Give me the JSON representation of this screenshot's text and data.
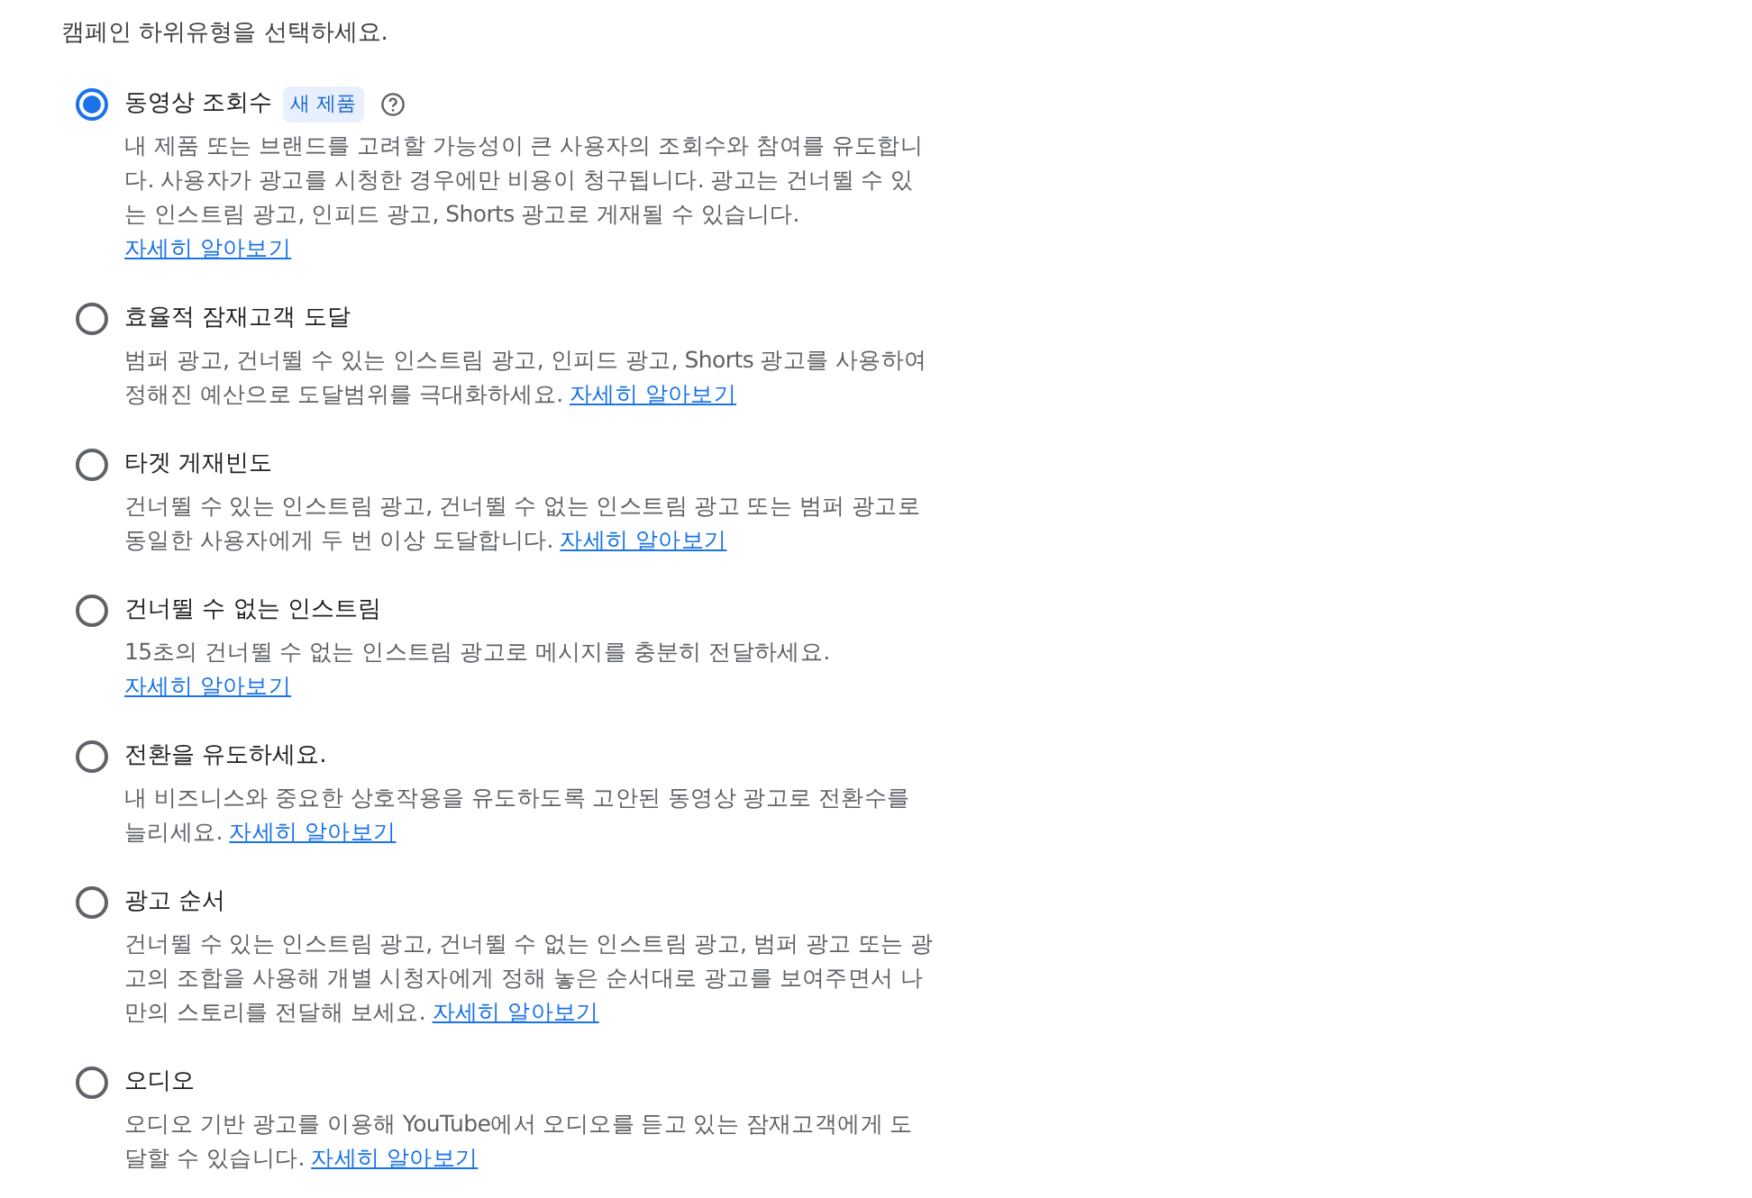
{
  "heading": "캠페인 하위유형을 선택하세요.",
  "options": [
    {
      "label": "동영상 조회수",
      "selected": true,
      "badge": "새 제품",
      "help": true,
      "description": "내 제품 또는 브랜드를 고려할 가능성이 큰 사용자의 조회수와 참여를 유도합니다. 사용자가 광고를 시청한 경우에만 비용이 청구됩니다. 광고는 건너뛸 수 있는 인스트림 광고, 인피드 광고, Shorts 광고로 게재될 수 있습니다.",
      "link": "자세히 알아보기"
    },
    {
      "label": "효율적 잠재고객 도달",
      "selected": false,
      "help": false,
      "description": "범퍼 광고, 건너뛸 수 있는 인스트림 광고, 인피드 광고, Shorts 광고를 사용하여 정해진 예산으로 도달범위를 극대화하세요.",
      "link": "자세히 알아보기"
    },
    {
      "label": "타겟 게재빈도",
      "selected": false,
      "help": false,
      "description": "건너뛸 수 있는 인스트림 광고, 건너뛸 수 없는 인스트림 광고 또는 범퍼 광고로 동일한 사용자에게 두 번 이상 도달합니다.",
      "link": "자세히 알아보기"
    },
    {
      "label": "건너뛸 수 없는 인스트림",
      "selected": false,
      "help": false,
      "description": "15초의 건너뛸 수 없는 인스트림 광고로 메시지를 충분히 전달하세요.",
      "link": "자세히 알아보기"
    },
    {
      "label": "전환을 유도하세요.",
      "selected": false,
      "help": false,
      "description": "내 비즈니스와 중요한 상호작용을 유도하도록 고안된 동영상 광고로 전환수를 늘리세요.",
      "link": "자세히 알아보기"
    },
    {
      "label": "광고 순서",
      "selected": false,
      "help": false,
      "description": "건너뛸 수 있는 인스트림 광고, 건너뛸 수 없는 인스트림 광고, 범퍼 광고 또는 광고의 조합을 사용해 개별 시청자에게 정해 놓은 순서대로 광고를 보여주면서 나만의 스토리를 전달해 보세요.",
      "link": "자세히 알아보기"
    },
    {
      "label": "오디오",
      "selected": false,
      "help": false,
      "description": "오디오 기반 광고를 이용해 YouTube에서 오디오를 듣고 있는 잠재고객에게 도달할 수 있습니다.",
      "link": "자세히 알아보기"
    }
  ]
}
